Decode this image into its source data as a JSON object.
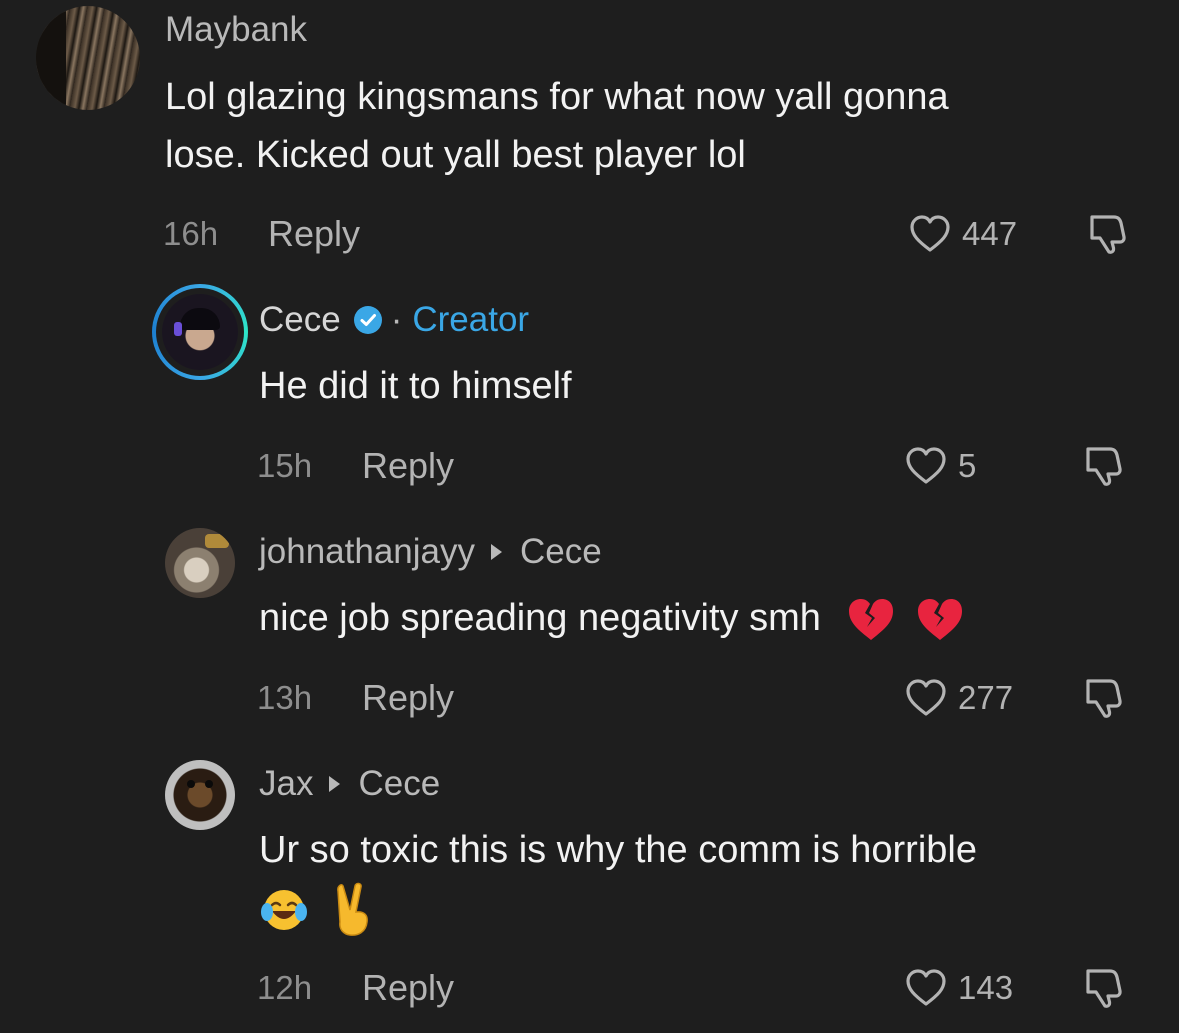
{
  "comments": [
    {
      "username": "Maybank",
      "text_lines": [
        "Lol glazing kingsmans for what now yall gonna",
        "lose. Kicked out yall best player lol"
      ],
      "time": "16h",
      "reply_label": "Reply",
      "likes": "447",
      "avatar_icon": "striped-photo-avatar"
    },
    {
      "username": "Cece",
      "separator": "·",
      "badge": "Creator",
      "verified_icon": "verified-check-icon",
      "text": "He did it to himself",
      "time": "15h",
      "reply_label": "Reply",
      "likes": "5",
      "avatar_icon": "creator-avatar"
    },
    {
      "username": "johnathanjayy",
      "reply_to": "Cece",
      "text": "nice job spreading negativity smh",
      "emojis": [
        "broken-heart",
        "broken-heart"
      ],
      "time": "13h",
      "reply_label": "Reply",
      "likes": "277",
      "avatar_icon": "cat-photo-avatar"
    },
    {
      "username": "Jax",
      "reply_to": "Cece",
      "text": "Ur so toxic this is why the comm is horrible",
      "emojis": [
        "laughing-tears",
        "victory-hand"
      ],
      "time": "12h",
      "reply_label": "Reply",
      "likes": "143",
      "avatar_icon": "dog-photo-avatar"
    }
  ],
  "colors": {
    "background": "#1e1e1e",
    "creator_accent": "#3aa7e6",
    "muted_text": "#8e8e8e",
    "body_text": "#f2f2f2"
  }
}
